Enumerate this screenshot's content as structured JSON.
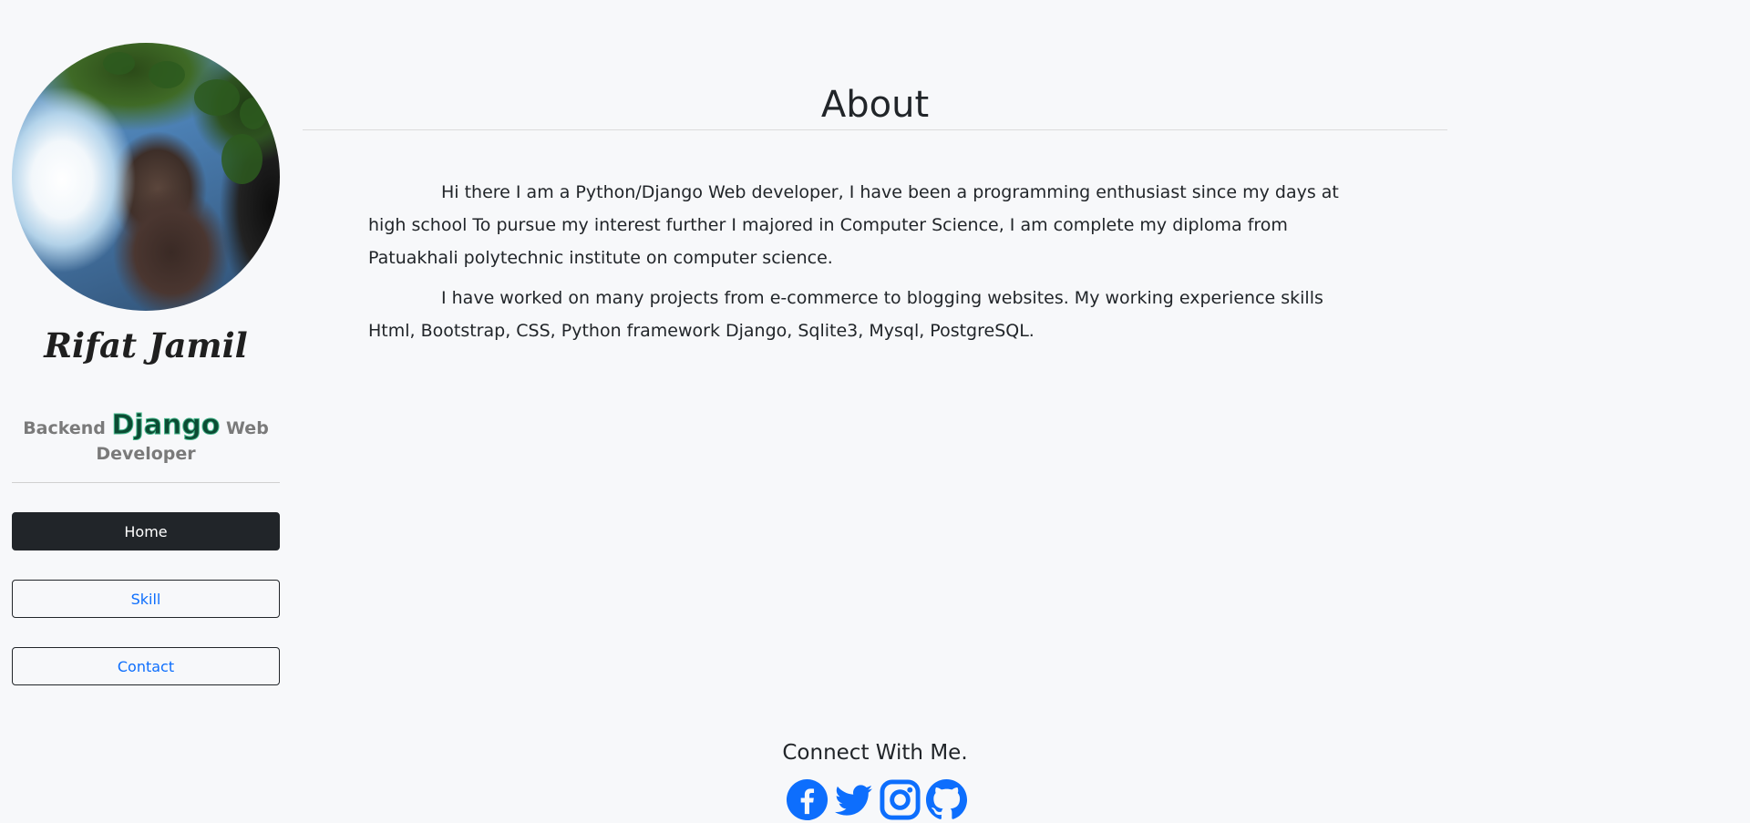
{
  "sidebar": {
    "name": "Rifat Jamil",
    "role": {
      "prefix": "Backend",
      "highlight": "Django",
      "suffix": "Web Developer"
    },
    "nav": [
      {
        "label": "Home",
        "active": true
      },
      {
        "label": "Skill",
        "active": false
      },
      {
        "label": "Contact",
        "active": false
      }
    ]
  },
  "main": {
    "title": "About",
    "paragraphs": [
      "Hi there I am a Python/Django Web developer, I have been a programming enthusiast since my days at high school To pursue my interest further I majored in Computer Science, I am complete my diploma from Patuakhali polytechnic institute on computer science.",
      "I have worked on many projects from e-commerce to blogging websites. My working experience skills Html, Bootstrap, CSS, Python framework Django, Sqlite3, Mysql, PostgreSQL."
    ]
  },
  "footer": {
    "heading": "Connect With Me.",
    "icons": [
      "facebook-icon",
      "twitter-icon",
      "instagram-icon",
      "github-icon"
    ]
  },
  "colors": {
    "background": "#f7f8fa",
    "accent": "#0d6efd",
    "dark": "#212529",
    "django_green": "#0c4b33"
  }
}
